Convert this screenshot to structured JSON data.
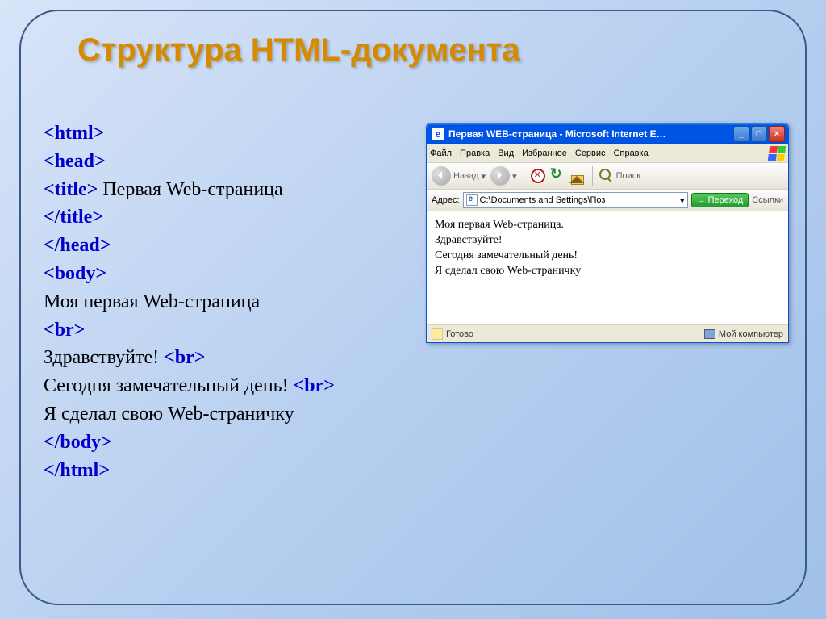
{
  "slide_title": "Структура HTML-документа",
  "code": {
    "l1": "<html>",
    "l2": "<head>",
    "l3_tag": "<title>",
    "l3_text": " Первая  Web-страница",
    "l4": "</title>",
    "l5": "</head>",
    "l6": "<body>",
    "l7_text": "Моя первая Web-страница",
    "l8": "<br>",
    "l9_text": "Здравствуйте! ",
    "l9_tag": "<br>",
    "l10_text": "Сегодня замечательный день! ",
    "l10_tag": "<br>",
    "l11_text": "Я сделал свою Web-страничку",
    "l12": "</body>",
    "l13": "</html>"
  },
  "ie": {
    "title": "Первая WEB-страница - Microsoft Internet E…",
    "menu": {
      "file": "Файл",
      "edit": "Правка",
      "view": "Вид",
      "favorites": "Избранное",
      "tools": "Сервис",
      "help": "Справка"
    },
    "toolbar": {
      "back": "Назад",
      "search": "Поиск"
    },
    "addrbar": {
      "label": "Адрес:",
      "path": "C:\\Documents and Settings\\Поз",
      "go": "Переход",
      "links": "Ссылки"
    },
    "content": {
      "l1": "Моя первая Web-страница.",
      "l2": "Здравствуйте!",
      "l3": "Сегодня замечательный день!",
      "l4": "Я сделал свою Web-страничку"
    },
    "status": {
      "ready": "Готово",
      "zone": "Мой компьютер"
    }
  }
}
